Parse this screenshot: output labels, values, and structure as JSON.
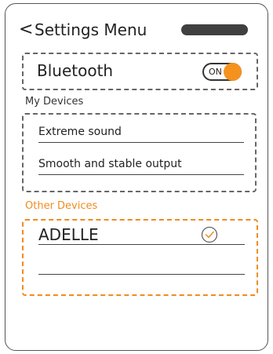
{
  "header": {
    "back_glyph": "<",
    "title": "Settings Menu"
  },
  "bluetooth": {
    "label": "Bluetooth",
    "toggle_text": "ON",
    "toggle_color": "#f5921e"
  },
  "my_devices": {
    "section_label": "My Devices",
    "items": [
      {
        "label": "Extreme sound"
      },
      {
        "label": "Smooth and stable output"
      }
    ]
  },
  "other_devices": {
    "section_label": "Other Devices",
    "accent_color": "#f08c1e",
    "items": [
      {
        "label": "ADELLE",
        "status_icon": "check-circle-icon"
      },
      {
        "label": ""
      }
    ]
  }
}
